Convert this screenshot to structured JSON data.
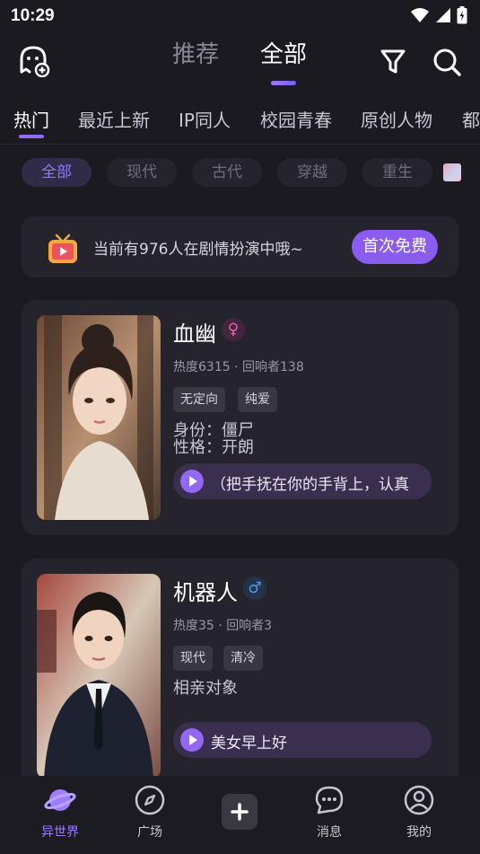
{
  "status_bar": {
    "time": "10:29",
    "icons": [
      "wifi-icon",
      "signal-icon",
      "battery-icon"
    ]
  },
  "top_nav": {
    "tabs": [
      {
        "label": "推荐",
        "active": false
      },
      {
        "label": "全部",
        "active": true
      }
    ],
    "icons": [
      "ghost-add-icon",
      "filter-icon",
      "search-icon"
    ]
  },
  "categories": {
    "items": [
      "热门",
      "最近上新",
      "IP同人",
      "校园青春",
      "原创人物",
      "都"
    ],
    "active": "热门"
  },
  "chips": {
    "items": [
      "全部",
      "现代",
      "古代",
      "穿越",
      "重生"
    ],
    "active": "全部"
  },
  "banner": {
    "text": "当前有976人在剧情扮演中哦~",
    "button": "首次免费",
    "icon": "tv-icon"
  },
  "cards": [
    {
      "name": "血幽",
      "gender": "female",
      "gender_symbol": "♀",
      "heat": "热度6315",
      "responders": "回响者138",
      "tags": [
        "无定向",
        "纯爱"
      ],
      "desc_lines": [
        "身份：僵尸",
        "性格：开朗"
      ],
      "audio_text": "（把手抚在你的手背上，认真"
    },
    {
      "name": "机器人",
      "gender": "male",
      "gender_symbol": "♂",
      "heat": "热度35",
      "responders": "回响者3",
      "tags": [
        "现代",
        "清冷"
      ],
      "desc_lines": [
        "相亲对象"
      ],
      "audio_text": "美女早上好"
    }
  ],
  "bottom_nav": {
    "items": [
      {
        "label": "异世界",
        "icon": "planet-icon",
        "active": true
      },
      {
        "label": "广场",
        "icon": "compass-icon",
        "active": false
      },
      {
        "label": "",
        "icon": "plus-icon",
        "active": false
      },
      {
        "label": "消息",
        "icon": "chat-icon",
        "active": false
      },
      {
        "label": "我的",
        "icon": "profile-icon",
        "active": false
      }
    ]
  },
  "colors": {
    "accent": "#8b5cf0",
    "background": "#1b1a21",
    "card": "#25242c"
  }
}
